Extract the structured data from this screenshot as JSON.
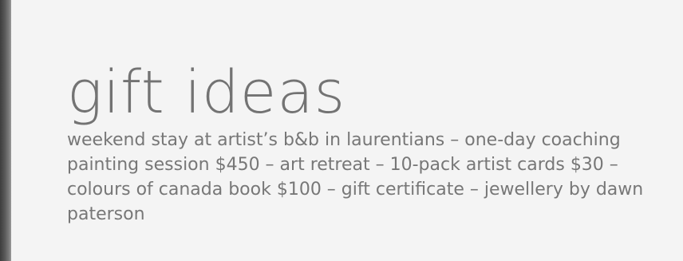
{
  "page": {
    "title": "gift ideas",
    "description": "weekend stay at artist’s b&b in laurentians – one-day coaching painting session $450 – art retreat – 10-pack artist cards $30 – colours of canada book $100 – gift certificate – jewellery by dawn paterson"
  },
  "colors": {
    "background": "#f4f4f4",
    "title": "#737373",
    "text": "#777777",
    "left_strip": "#5a5a5a"
  }
}
